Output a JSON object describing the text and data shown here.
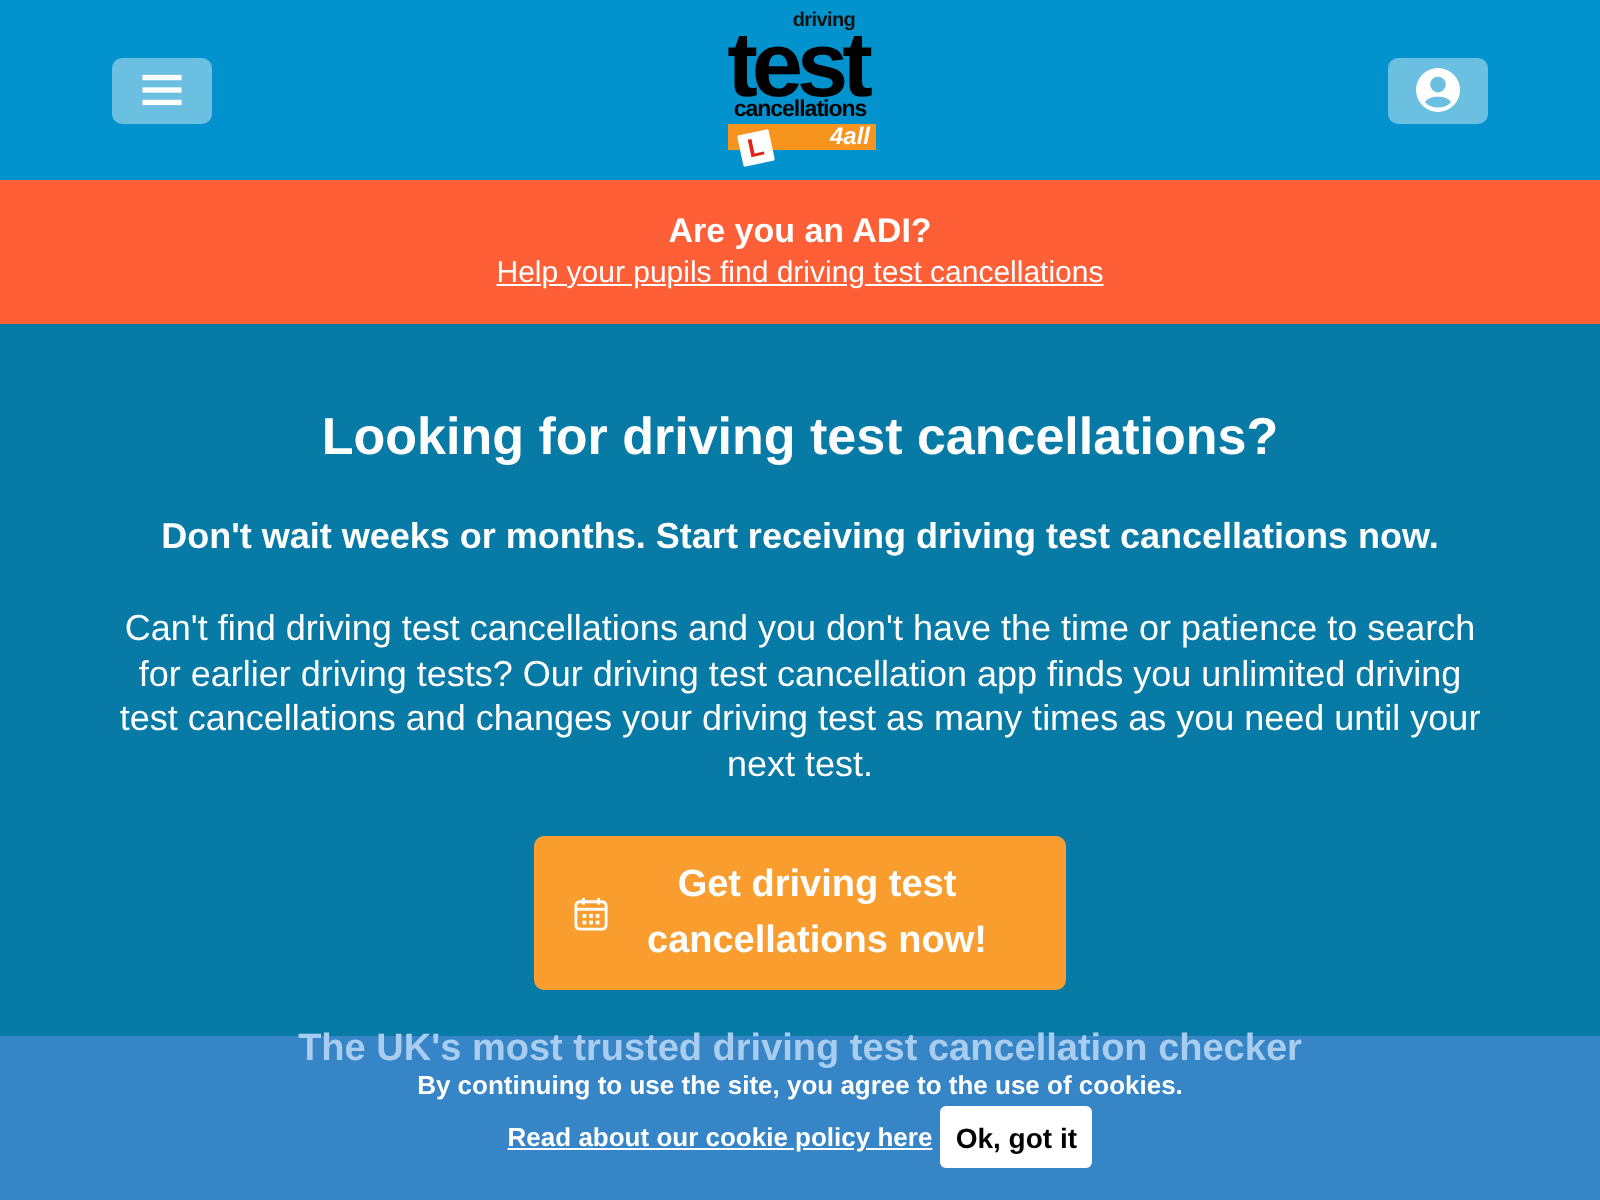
{
  "header": {
    "logo": {
      "small_text": "driving",
      "title": "test",
      "subtitle": "cancellations",
      "tag": "4all",
      "plate": "L"
    }
  },
  "adi_banner": {
    "title": "Are you an ADI?",
    "link": "Help your pupils find driving test cancellations"
  },
  "hero": {
    "title": "Looking for driving test cancellations?",
    "subtitle": "Don't wait weeks or months. Start receiving driving test cancellations now.",
    "body": "Can't find driving test cancellations and you don't have the time or patience to search for earlier driving tests? Our driving test cancellation app finds you unlimited driving test cancellations and changes your driving test as many times as you need until your next test.",
    "cta": {
      "label": "Get driving test cancellations now!"
    },
    "tagline": "The UK's most trusted driving test cancellation checker"
  },
  "cookie_banner": {
    "message": "By continuing to use the site, you agree to the use of cookies.",
    "policy_link": "Read about our cookie policy here",
    "accept_button": "Ok, got it"
  }
}
